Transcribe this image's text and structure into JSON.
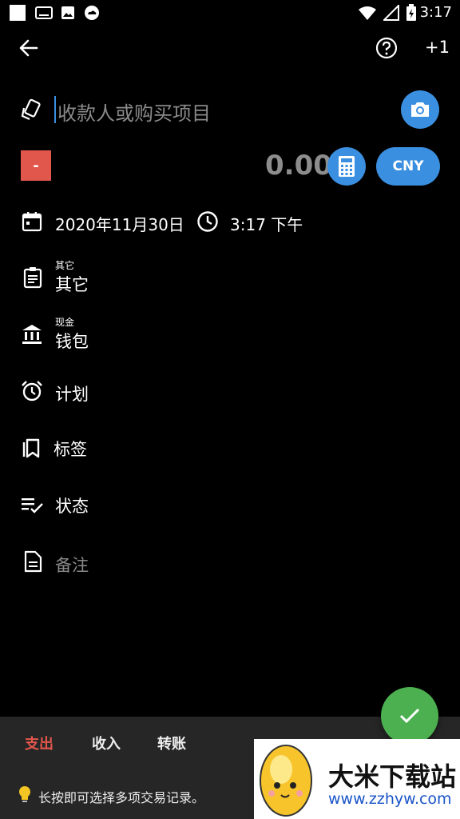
{
  "status": {
    "time": "3:17"
  },
  "toolbar": {
    "plus_one": "+1"
  },
  "payee": {
    "placeholder": "收款人或购买项目"
  },
  "amount": {
    "sign": "-",
    "value": "0.00",
    "currency": "CNY"
  },
  "datetime": {
    "date": "2020年11月30日",
    "time": "3:17 下午"
  },
  "category": {
    "parent": "其它",
    "name": "其它"
  },
  "account": {
    "group": "现金",
    "name": "钱包"
  },
  "plan": {
    "label": "计划"
  },
  "tags": {
    "label": "标签"
  },
  "status_row": {
    "label": "状态"
  },
  "note": {
    "placeholder": "备注"
  },
  "tabs": [
    {
      "label": "支出",
      "color": "#e2574c"
    },
    {
      "label": "收入"
    },
    {
      "label": "转账"
    }
  ],
  "hint": "长按即可选择多项交易记录。",
  "banner": {
    "title": "大米下载站",
    "url": "www.zzhyw.com"
  },
  "colors": {
    "accent": "#3a8fe0",
    "expense_red": "#e2574c",
    "confirm_green": "#4caf50"
  }
}
